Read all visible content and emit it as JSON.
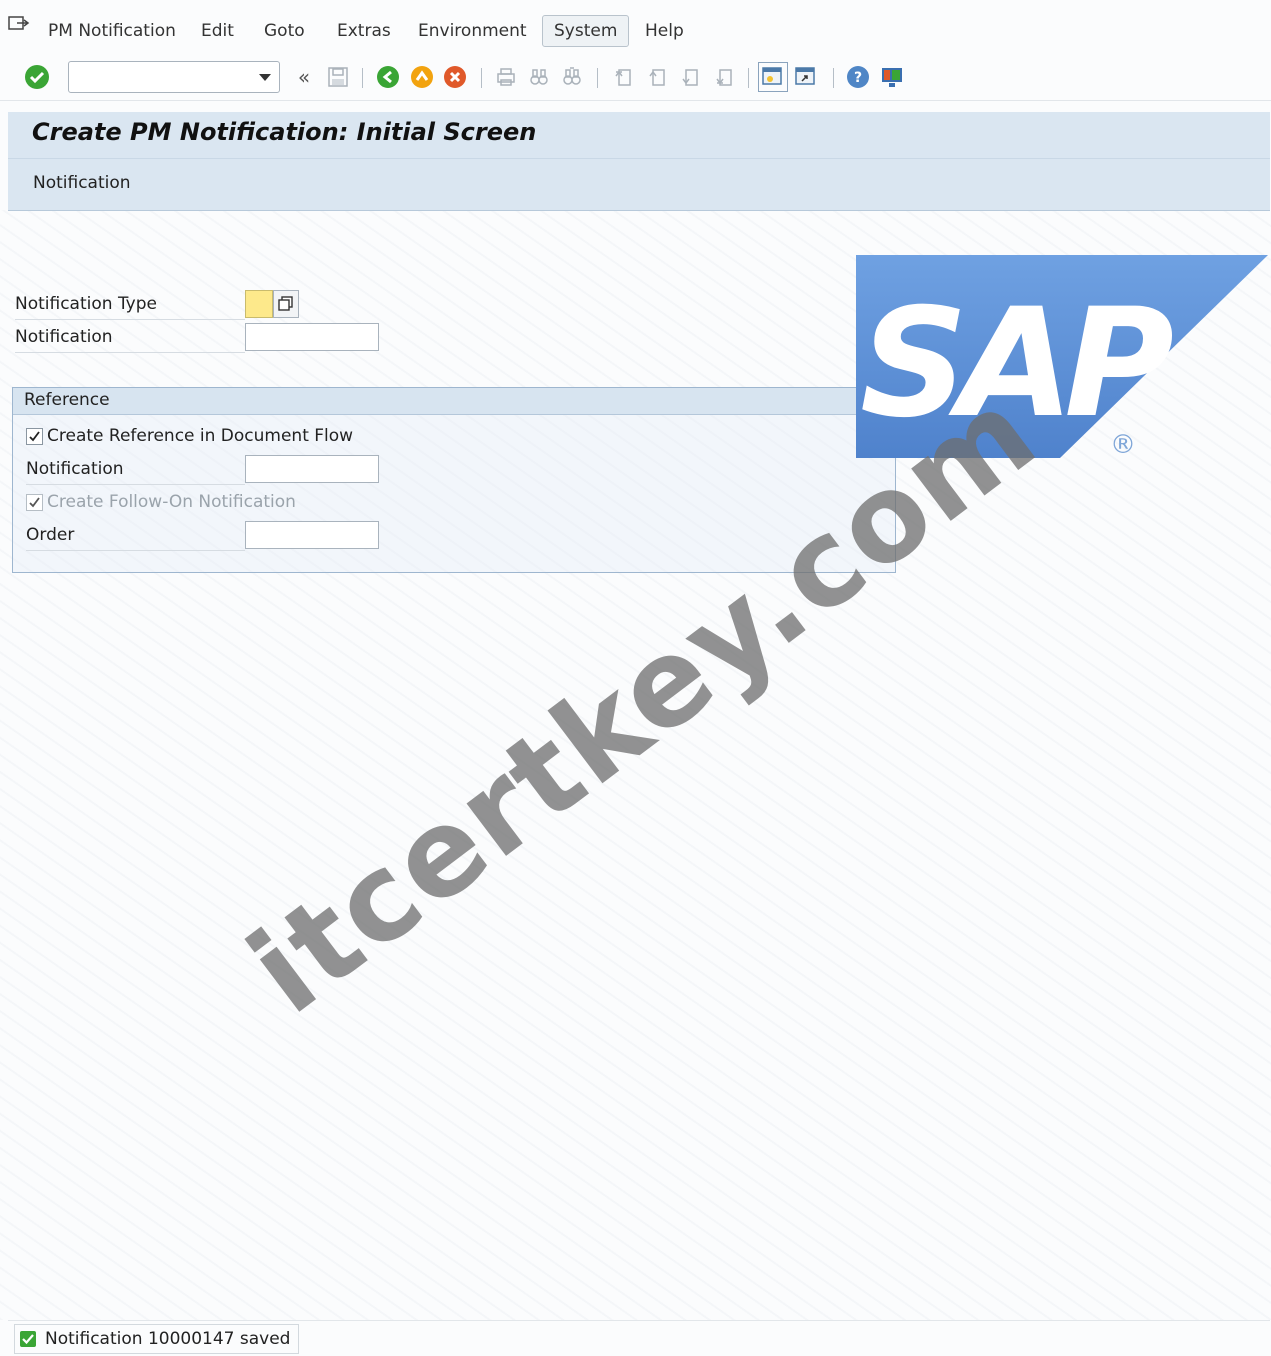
{
  "menu": {
    "items": [
      "PM Notification",
      "Edit",
      "Goto",
      "Extras",
      "Environment",
      "System",
      "Help"
    ]
  },
  "toolbar": {
    "command_field_value": "",
    "icons": [
      "enter-icon",
      "command-dropdown-icon",
      "collapse-icon",
      "save-icon",
      "back-icon",
      "exit-icon",
      "cancel-icon",
      "print-icon",
      "find-icon",
      "find-next-icon",
      "first-page-icon",
      "previous-page-icon",
      "next-page-icon",
      "last-page-icon",
      "new-session-icon",
      "shortcut-icon",
      "help-icon",
      "layout-menu-icon"
    ]
  },
  "title": {
    "text": "Create PM Notification: Initial Screen",
    "application_toolbar_item": "Notification"
  },
  "form": {
    "notification_type_label": "Notification Type",
    "notification_type_value": "",
    "notification_label": "Notification",
    "notification_value": ""
  },
  "reference": {
    "title": "Reference",
    "create_reference_label": "Create Reference in Document Flow",
    "create_reference_checked": true,
    "notification_label": "Notification",
    "notification_value": "",
    "follow_on_label": "Create Follow-On Notification",
    "follow_on_checked": true,
    "order_label": "Order",
    "order_value": ""
  },
  "logo": {
    "text": "SAP",
    "registered": "®",
    "brand_color": "#5d8fd6"
  },
  "watermark": {
    "text": "itcertkey.com"
  },
  "status": {
    "message": "Notification 10000147 saved",
    "type": "success"
  },
  "colors": {
    "success_green": "#3aa535",
    "required_field": "#fde98b",
    "title_bar": "#dae6f1"
  }
}
